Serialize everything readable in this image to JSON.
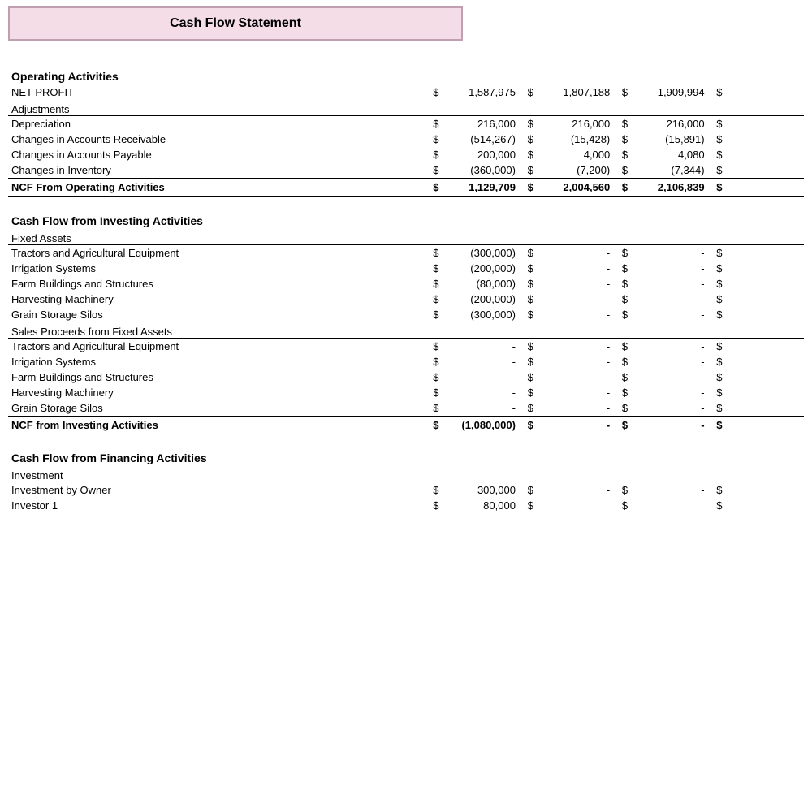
{
  "title": "Cash Flow Statement",
  "sections": [
    {
      "type": "section-header",
      "label": "Operating Activities"
    },
    {
      "type": "data-row",
      "label": "NET PROFIT",
      "col1_dollar": "$",
      "col1_value": "1,587,975",
      "col2_dollar": "$",
      "col2_value": "1,807,188",
      "col3_dollar": "$",
      "col3_value": "1,909,994",
      "col4_dollar": "$",
      "col4_value": ""
    },
    {
      "type": "sub-header",
      "label": "Adjustments"
    },
    {
      "type": "data-row",
      "label": "Depreciation",
      "col1_dollar": "$",
      "col1_value": "216,000",
      "col2_dollar": "$",
      "col2_value": "216,000",
      "col3_dollar": "$",
      "col3_value": "216,000",
      "col4_dollar": "$",
      "col4_value": ""
    },
    {
      "type": "data-row",
      "label": "Changes in Accounts Receivable",
      "col1_dollar": "$",
      "col1_value": "(514,267)",
      "col2_dollar": "$",
      "col2_value": "(15,428)",
      "col3_dollar": "$",
      "col3_value": "(15,891)",
      "col4_dollar": "$",
      "col4_value": ""
    },
    {
      "type": "data-row",
      "label": "Changes in Accounts Payable",
      "col1_dollar": "$",
      "col1_value": "200,000",
      "col2_dollar": "$",
      "col2_value": "4,000",
      "col3_dollar": "$",
      "col3_value": "4,080",
      "col4_dollar": "$",
      "col4_value": ""
    },
    {
      "type": "data-row",
      "label": "Changes in Inventory",
      "col1_dollar": "$",
      "col1_value": "(360,000)",
      "col2_dollar": "$",
      "col2_value": "(7,200)",
      "col3_dollar": "$",
      "col3_value": "(7,344)",
      "col4_dollar": "$",
      "col4_value": ""
    },
    {
      "type": "total-row",
      "label": "NCF From Operating Activities",
      "col1_dollar": "$",
      "col1_value": "1,129,709",
      "col2_dollar": "$",
      "col2_value": "2,004,560",
      "col3_dollar": "$",
      "col3_value": "2,106,839",
      "col4_dollar": "$",
      "col4_value": ""
    },
    {
      "type": "section-header",
      "label": "Cash Flow from Investing Activities"
    },
    {
      "type": "sub-header",
      "label": "Fixed Assets"
    },
    {
      "type": "data-row",
      "label": "Tractors and Agricultural Equipment",
      "col1_dollar": "$",
      "col1_value": "(300,000)",
      "col2_dollar": "$",
      "col2_value": "-",
      "col3_dollar": "$",
      "col3_value": "-",
      "col4_dollar": "$",
      "col4_value": ""
    },
    {
      "type": "data-row",
      "label": "Irrigation Systems",
      "col1_dollar": "$",
      "col1_value": "(200,000)",
      "col2_dollar": "$",
      "col2_value": "-",
      "col3_dollar": "$",
      "col3_value": "-",
      "col4_dollar": "$",
      "col4_value": ""
    },
    {
      "type": "data-row",
      "label": "Farm Buildings and Structures",
      "col1_dollar": "$",
      "col1_value": "(80,000)",
      "col2_dollar": "$",
      "col2_value": "-",
      "col3_dollar": "$",
      "col3_value": "-",
      "col4_dollar": "$",
      "col4_value": ""
    },
    {
      "type": "data-row",
      "label": "Harvesting Machinery",
      "col1_dollar": "$",
      "col1_value": "(200,000)",
      "col2_dollar": "$",
      "col2_value": "-",
      "col3_dollar": "$",
      "col3_value": "-",
      "col4_dollar": "$",
      "col4_value": ""
    },
    {
      "type": "data-row",
      "label": "Grain Storage Silos",
      "col1_dollar": "$",
      "col1_value": "(300,000)",
      "col2_dollar": "$",
      "col2_value": "-",
      "col3_dollar": "$",
      "col3_value": "-",
      "col4_dollar": "$",
      "col4_value": ""
    },
    {
      "type": "sub-header",
      "label": "Sales Proceeds from Fixed Assets"
    },
    {
      "type": "data-row",
      "label": "Tractors and Agricultural Equipment",
      "col1_dollar": "$",
      "col1_value": "-",
      "col2_dollar": "$",
      "col2_value": "-",
      "col3_dollar": "$",
      "col3_value": "-",
      "col4_dollar": "$",
      "col4_value": ""
    },
    {
      "type": "data-row",
      "label": "Irrigation Systems",
      "col1_dollar": "$",
      "col1_value": "-",
      "col2_dollar": "$",
      "col2_value": "-",
      "col3_dollar": "$",
      "col3_value": "-",
      "col4_dollar": "$",
      "col4_value": ""
    },
    {
      "type": "data-row",
      "label": "Farm Buildings and Structures",
      "col1_dollar": "$",
      "col1_value": "-",
      "col2_dollar": "$",
      "col2_value": "-",
      "col3_dollar": "$",
      "col3_value": "-",
      "col4_dollar": "$",
      "col4_value": ""
    },
    {
      "type": "data-row",
      "label": "Harvesting Machinery",
      "col1_dollar": "$",
      "col1_value": "-",
      "col2_dollar": "$",
      "col2_value": "-",
      "col3_dollar": "$",
      "col3_value": "-",
      "col4_dollar": "$",
      "col4_value": ""
    },
    {
      "type": "data-row",
      "label": "Grain Storage Silos",
      "col1_dollar": "$",
      "col1_value": "-",
      "col2_dollar": "$",
      "col2_value": "-",
      "col3_dollar": "$",
      "col3_value": "-",
      "col4_dollar": "$",
      "col4_value": ""
    },
    {
      "type": "total-row",
      "label": "NCF from Investing Activities",
      "col1_dollar": "$",
      "col1_value": "(1,080,000)",
      "col2_dollar": "$",
      "col2_value": "-",
      "col3_dollar": "$",
      "col3_value": "-",
      "col4_dollar": "$",
      "col4_value": ""
    },
    {
      "type": "section-header",
      "label": "Cash Flow from Financing Activities"
    },
    {
      "type": "sub-header",
      "label": "Investment"
    },
    {
      "type": "data-row",
      "label": "Investment by Owner",
      "col1_dollar": "$",
      "col1_value": "300,000",
      "col2_dollar": "$",
      "col2_value": "-",
      "col3_dollar": "$",
      "col3_value": "-",
      "col4_dollar": "$",
      "col4_value": ""
    },
    {
      "type": "data-row",
      "label": "Investor 1",
      "col1_dollar": "$",
      "col1_value": "80,000",
      "col2_dollar": "$",
      "col2_value": "",
      "col3_dollar": "$",
      "col3_value": "",
      "col4_dollar": "$",
      "col4_value": ""
    }
  ]
}
